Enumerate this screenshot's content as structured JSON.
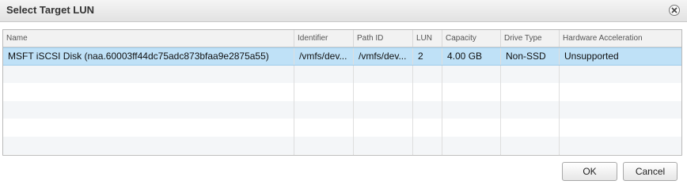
{
  "dialog": {
    "title": "Select Target LUN",
    "close_icon": "close-icon"
  },
  "table": {
    "columns": [
      "Name",
      "Identifier",
      "Path ID",
      "LUN",
      "Capacity",
      "Drive Type",
      "Hardware Acceleration"
    ],
    "rows": [
      [
        "MSFT iSCSI Disk (naa.60003ff44dc75adc873bfaa9e2875a55)",
        "/vmfs/dev...",
        "/vmfs/dev...",
        "2",
        "4.00 GB",
        "Non-SSD",
        "Unsupported"
      ]
    ],
    "selected_row": 0,
    "colors": {
      "selected": "#bfe1f7",
      "stripe": "#f4f6f8"
    }
  },
  "buttons": {
    "ok": "OK",
    "cancel": "Cancel"
  }
}
